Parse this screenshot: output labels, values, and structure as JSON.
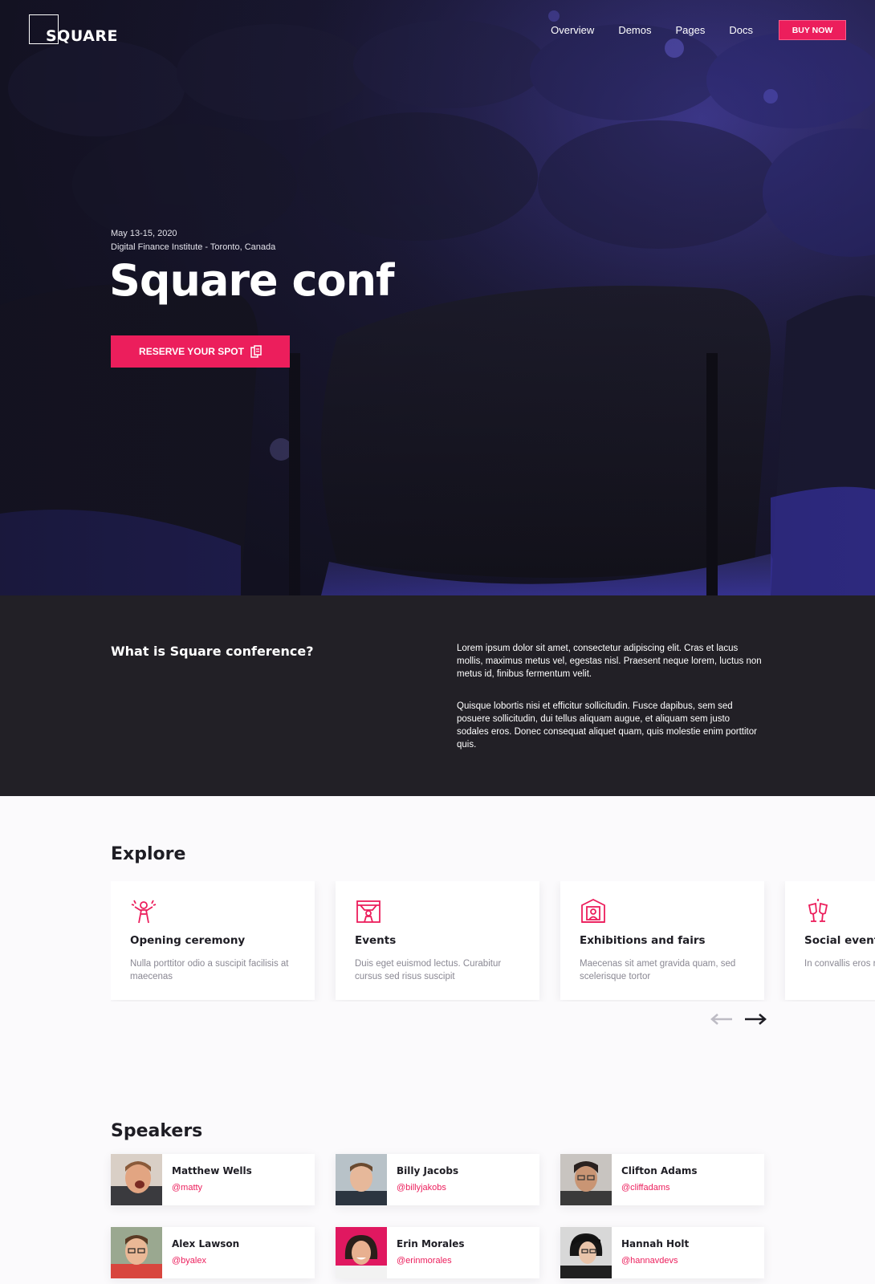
{
  "nav": {
    "logo_text": "SQUARE",
    "links": [
      "Overview",
      "Demos",
      "Pages",
      "Docs"
    ],
    "buy_label": "BUY NOW"
  },
  "hero": {
    "date": "May 13-15, 2020",
    "venue": "Digital Finance Institute - Toronto, Canada",
    "title": "Square conf",
    "cta_label": "RESERVE YOUR SPOT",
    "cta_icon": "ticket-icon"
  },
  "about": {
    "heading": "What is Square conference?",
    "paragraph_1": "Lorem ipsum dolor sit amet, consectetur adipiscing elit. Cras et lacus mollis, maximus metus vel, egestas nisl. Praesent neque lorem, luctus non metus id, finibus fermentum velit.",
    "paragraph_2": "Quisque lobortis nisi et efficitur sollicitudin. Fusce dapibus, sem sed posuere sollicitudin, dui tellus aliquam augue, et aliquam sem justo sodales eros. Donec consequat aliquet quam, quis molestie enim porttitor quis."
  },
  "explore": {
    "heading": "Explore",
    "cards": [
      {
        "icon": "ceremony-icon",
        "title": "Opening ceremony",
        "text": "Nulla porttitor odio a suscipit facilisis at maecenas"
      },
      {
        "icon": "events-icon",
        "title": "Events",
        "text": "Duis eget euismod lectus. Curabitur cursus sed risus suscipit"
      },
      {
        "icon": "exhibition-icon",
        "title": "Exhibitions and fairs",
        "text": "Maecenas sit amet gravida quam, sed scelerisque tortor"
      },
      {
        "icon": "social-icon",
        "title": "Social events",
        "text": "In convallis eros rhoncus. Donec p"
      }
    ],
    "prev_icon": "arrow-left-icon",
    "next_icon": "arrow-right-icon"
  },
  "speakers": {
    "heading": "Speakers",
    "list": [
      {
        "name": "Matthew Wells",
        "handle": "@matty"
      },
      {
        "name": "Billy Jacobs",
        "handle": "@billyjakobs"
      },
      {
        "name": "Clifton Adams",
        "handle": "@cliffadams"
      },
      {
        "name": "Alex Lawson",
        "handle": "@byalex"
      },
      {
        "name": "Erin Morales",
        "handle": "@erinmorales"
      },
      {
        "name": "Hannah Holt",
        "handle": "@hannavdevs"
      }
    ]
  },
  "colors": {
    "accent": "#ec1e5c",
    "dark": "#222026",
    "text": "#1e1d24",
    "muted": "#8a8893"
  }
}
